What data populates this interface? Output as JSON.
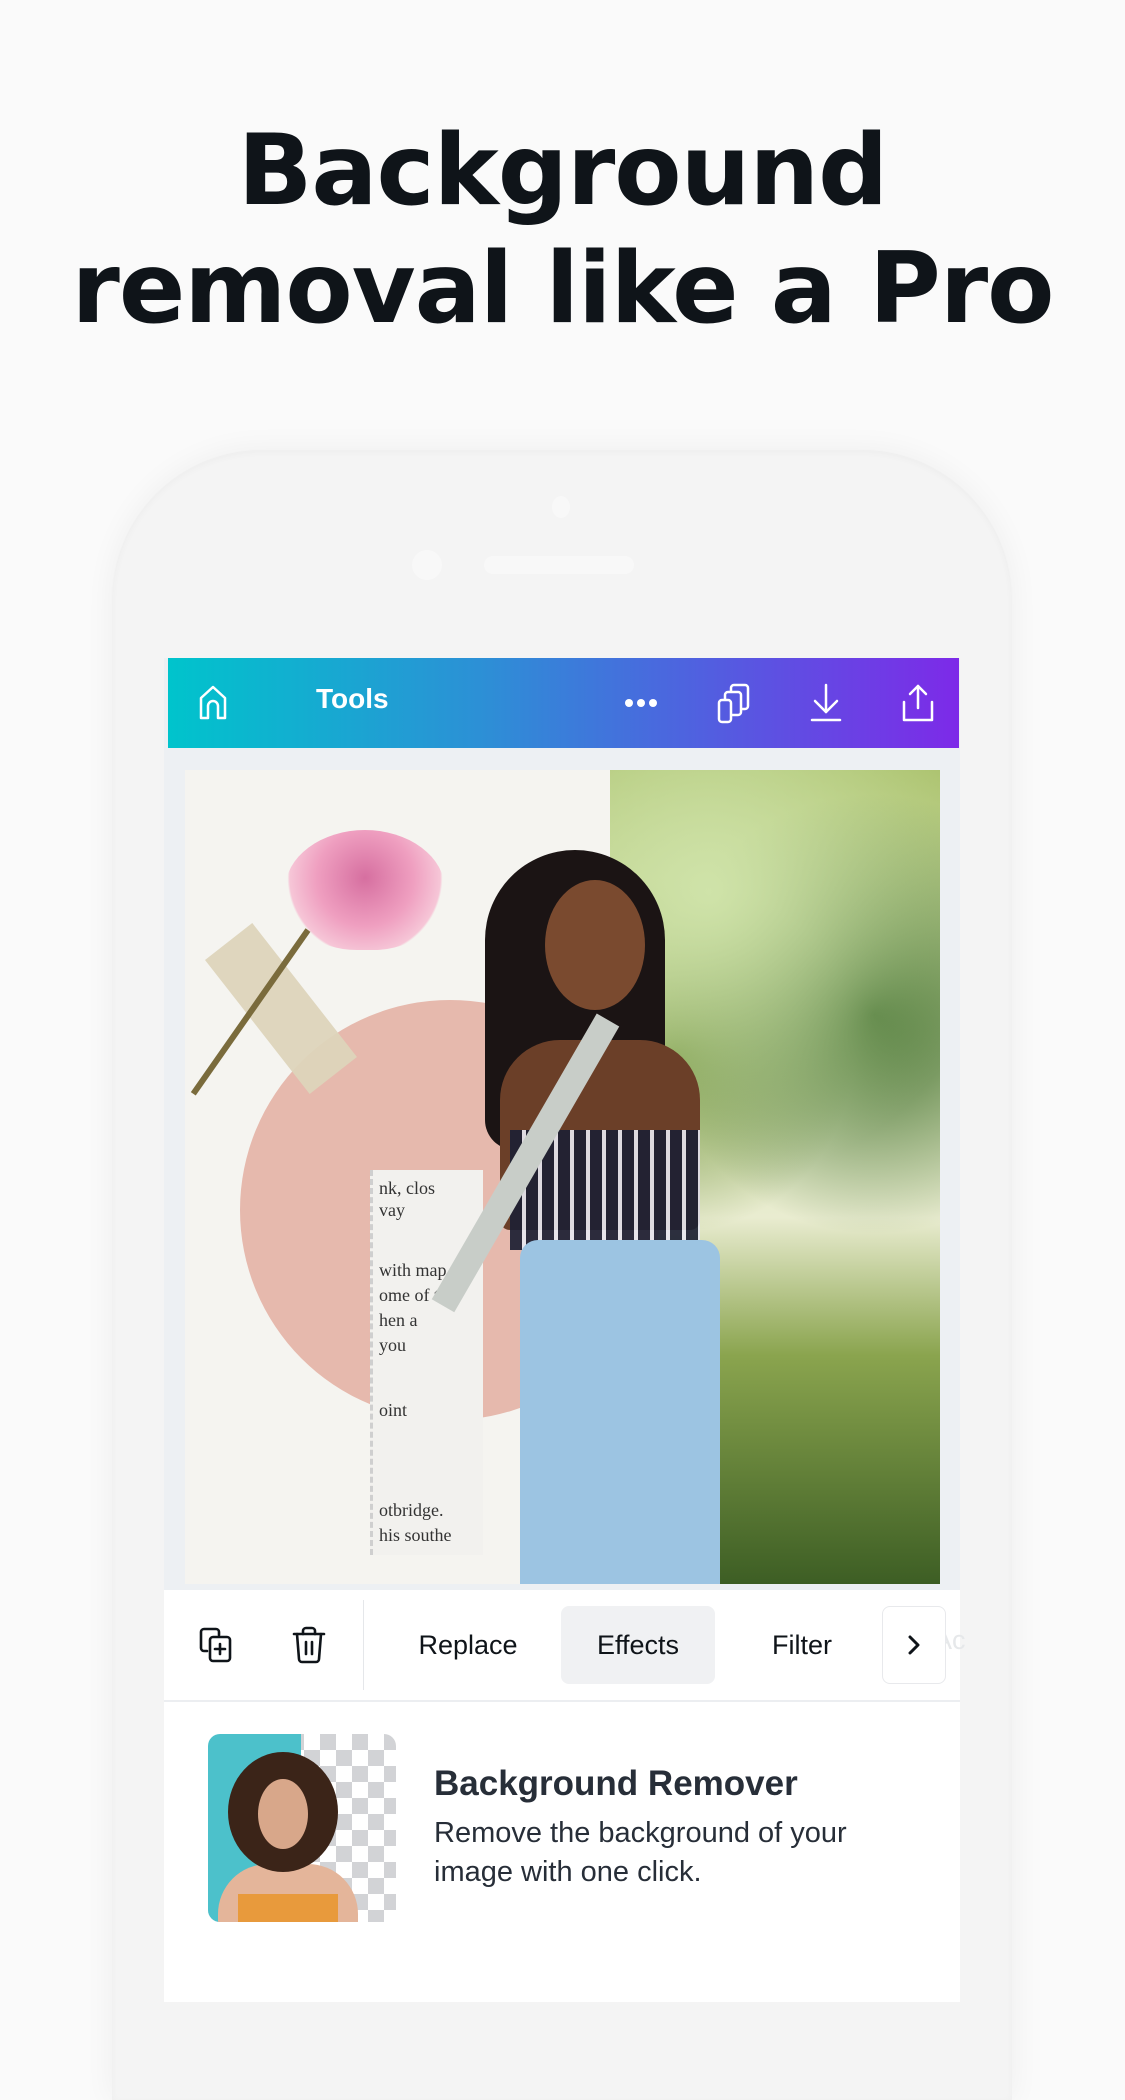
{
  "headline": {
    "line1": "Background",
    "line2": "removal like a Pro"
  },
  "app": {
    "brand_gradient": [
      "#00c4cc",
      "#7d2ae8"
    ],
    "topbar": {
      "title": "Tools",
      "icons": [
        "home-icon",
        "more-icon",
        "pages-icon",
        "download-icon",
        "share-icon"
      ]
    },
    "canvas": {
      "paper_text": [
        "nk, clos",
        "vay",
        "with map,",
        "ome of th",
        "hen a",
        "you",
        "oint",
        "otbridge.",
        "his southe"
      ]
    },
    "toolbar": {
      "icons": [
        "duplicate-icon",
        "trash-icon"
      ],
      "tabs": [
        {
          "label": "Replace",
          "active": false
        },
        {
          "label": "Effects",
          "active": true
        },
        {
          "label": "Filter",
          "active": false
        }
      ],
      "next_icon": "chevron-right-icon",
      "faded_label": "Ac"
    },
    "effect_card": {
      "title": "Background Remover",
      "description": "Remove the background of your image with one click."
    }
  }
}
